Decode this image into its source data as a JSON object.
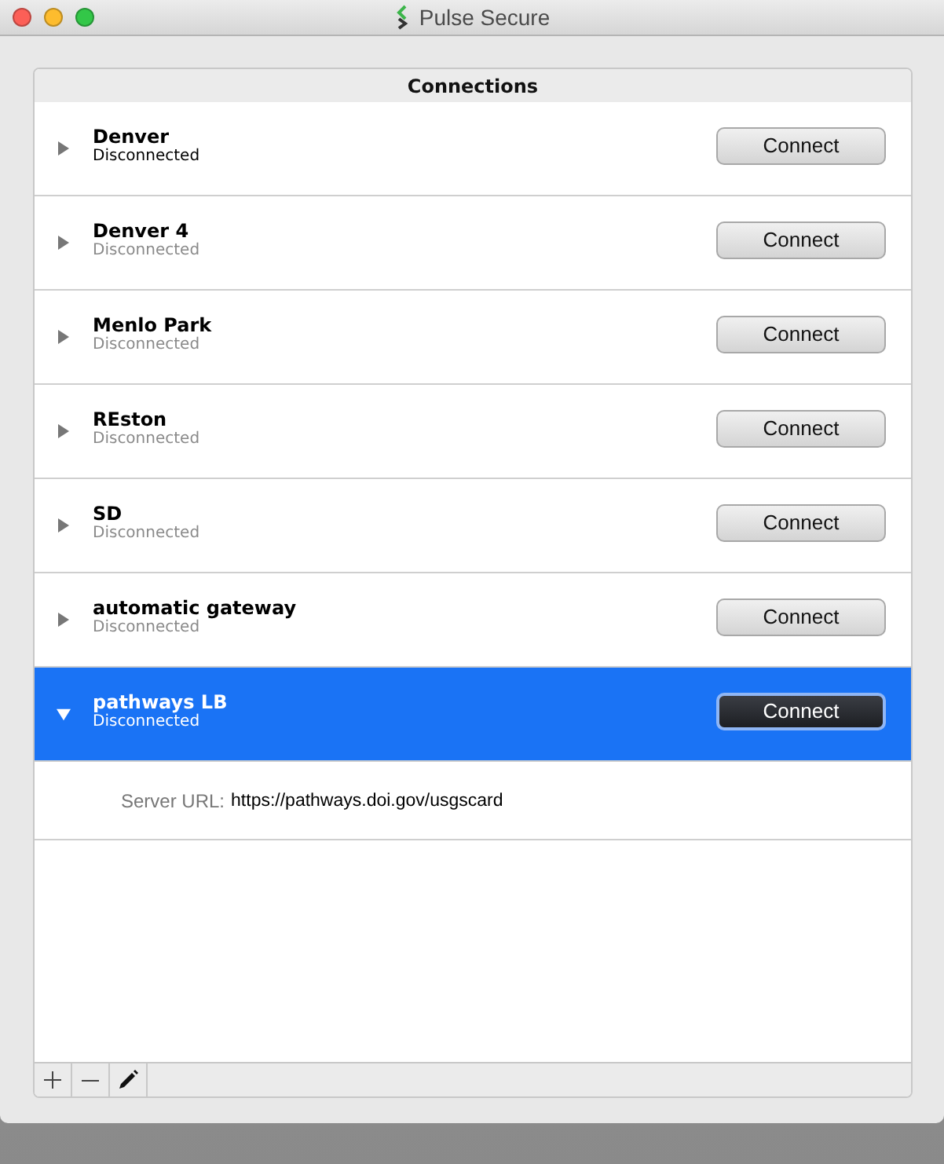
{
  "window": {
    "title": "Pulse Secure"
  },
  "connections": {
    "title": "Connections",
    "items": [
      {
        "name": "Denver",
        "status": "Disconnected",
        "status_dimmed": false,
        "expanded": false,
        "selected": false,
        "button": "Connect"
      },
      {
        "name": "Denver 4",
        "status": "Disconnected",
        "status_dimmed": true,
        "expanded": false,
        "selected": false,
        "button": "Connect"
      },
      {
        "name": "Menlo Park",
        "status": "Disconnected",
        "status_dimmed": true,
        "expanded": false,
        "selected": false,
        "button": "Connect"
      },
      {
        "name": "REston",
        "status": "Disconnected",
        "status_dimmed": true,
        "expanded": false,
        "selected": false,
        "button": "Connect"
      },
      {
        "name": "SD",
        "status": "Disconnected",
        "status_dimmed": true,
        "expanded": false,
        "selected": false,
        "button": "Connect"
      },
      {
        "name": "automatic gateway",
        "status": "Disconnected",
        "status_dimmed": true,
        "expanded": false,
        "selected": false,
        "button": "Connect"
      },
      {
        "name": "pathways LB",
        "status": "Disconnected",
        "status_dimmed": false,
        "expanded": true,
        "selected": true,
        "button": "Connect",
        "details": [
          {
            "label": "Server URL:",
            "value": "https://pathways.doi.gov/usgscard"
          }
        ]
      }
    ]
  }
}
